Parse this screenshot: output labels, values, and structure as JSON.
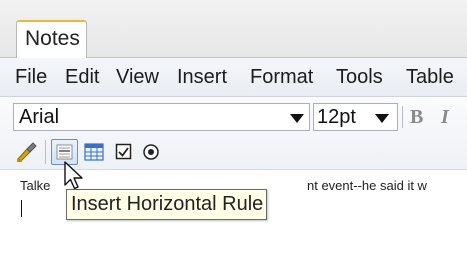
{
  "tab": {
    "label": "Notes"
  },
  "menubar": {
    "items": [
      "File",
      "Edit",
      "View",
      "Insert",
      "Format",
      "Tools",
      "Table"
    ]
  },
  "toolbar": {
    "font_value": "Arial",
    "size_value": "12pt",
    "bold_label": "B",
    "italic_label": "I",
    "icons": [
      "format-painter-icon",
      "horizontal-rule-icon",
      "table-icon",
      "checkbox-icon",
      "radio-button-icon"
    ]
  },
  "editor": {
    "text_left": "Talke",
    "text_right": "nt event--he said it w"
  },
  "tooltip": {
    "text": "Insert Horizontal Rule"
  },
  "colors": {
    "tab_accent": "#f0b63b",
    "tooltip_bg": "#fffee6",
    "table_icon": "#3a6fc4"
  }
}
